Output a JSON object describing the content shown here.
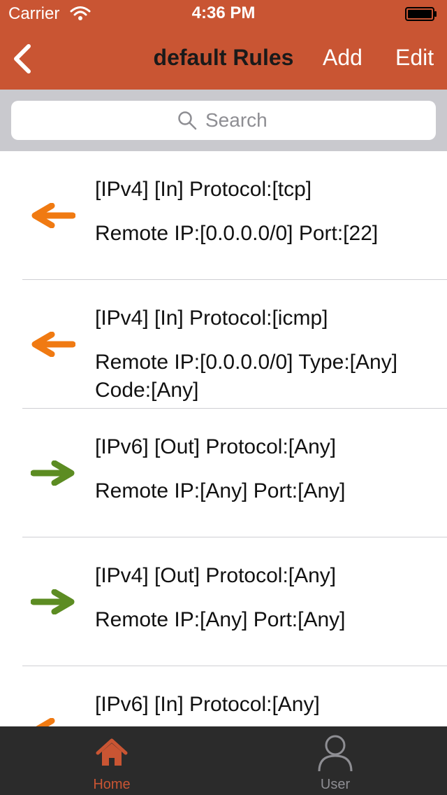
{
  "status_bar": {
    "carrier": "Carrier",
    "time": "4:36 PM"
  },
  "nav": {
    "back_icon": "chevron-left-icon",
    "title": "default Rules",
    "add_label": "Add",
    "edit_label": "Edit"
  },
  "search": {
    "placeholder": "Search",
    "value": ""
  },
  "rules": [
    {
      "direction": "in",
      "icon": "arrow-left-icon",
      "color": "#f07a12",
      "line1": "[IPv4] [In] Protocol:[tcp]",
      "line2": "Remote IP:[0.0.0.0/0] Port:[22]"
    },
    {
      "direction": "in",
      "icon": "arrow-left-icon",
      "color": "#f07a12",
      "line1": "[IPv4] [In] Protocol:[icmp]",
      "line2": "Remote IP:[0.0.0.0/0] Type:[Any] Code:[Any]"
    },
    {
      "direction": "out",
      "icon": "arrow-right-icon",
      "color": "#5c8c22",
      "line1": "[IPv6] [Out] Protocol:[Any]",
      "line2": "Remote IP:[Any] Port:[Any]"
    },
    {
      "direction": "out",
      "icon": "arrow-right-icon",
      "color": "#5c8c22",
      "line1": "[IPv4] [Out] Protocol:[Any]",
      "line2": "Remote IP:[Any] Port:[Any]"
    },
    {
      "direction": "in",
      "icon": "arrow-left-icon",
      "color": "#f07a12",
      "line1": "[IPv6] [In] Protocol:[Any]",
      "line2": ""
    }
  ],
  "tabs": [
    {
      "label": "Home",
      "icon": "home-icon",
      "selected": true
    },
    {
      "label": "User",
      "icon": "user-icon",
      "selected": false
    }
  ],
  "colors": {
    "header": "#c95533",
    "accent": "#c95533",
    "inbound": "#f07a12",
    "outbound": "#5c8c22",
    "tab_bar": "#2b2b2b"
  }
}
